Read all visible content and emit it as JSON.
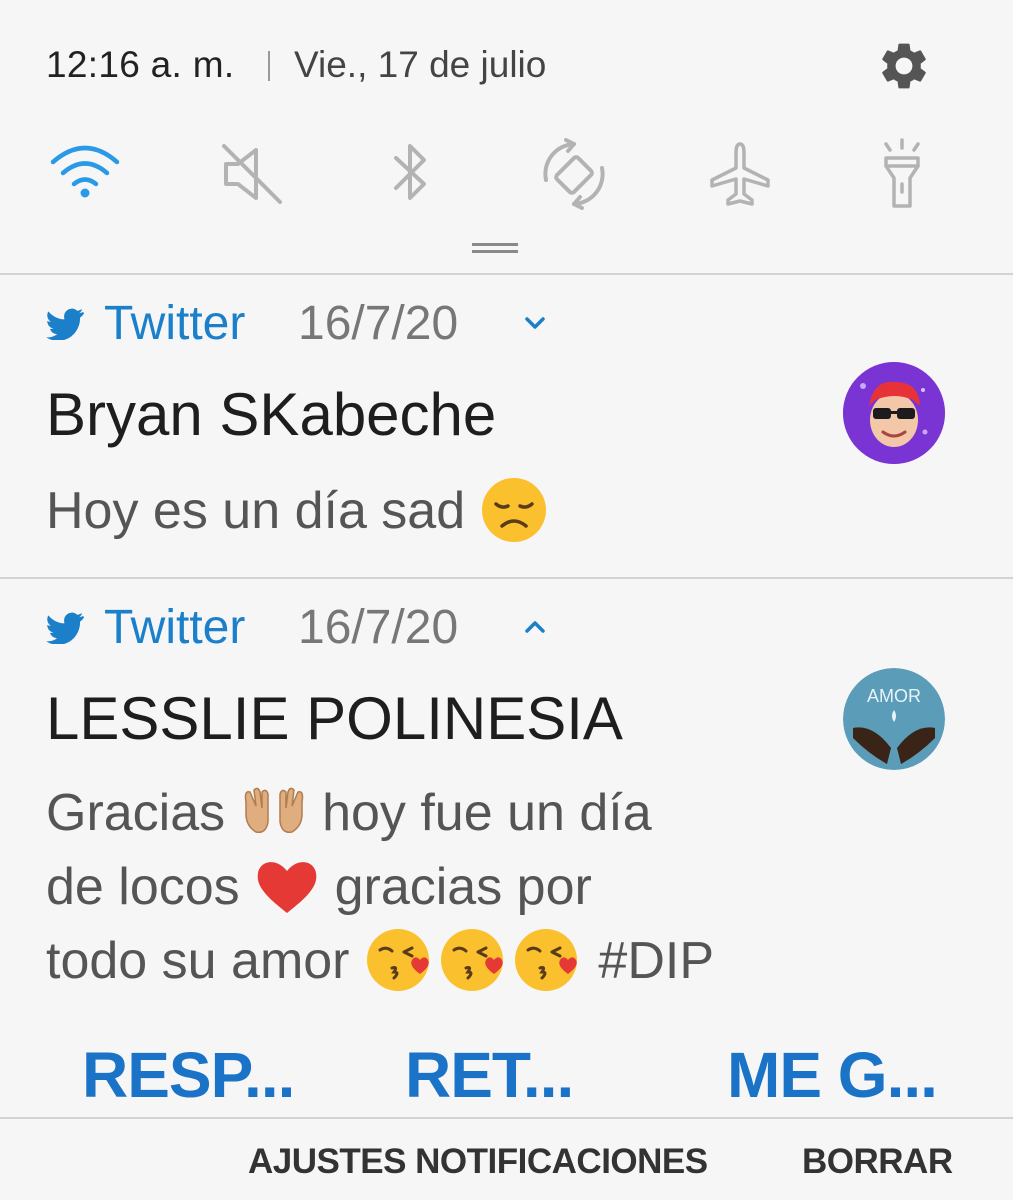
{
  "status": {
    "time": "12:16 a. m.",
    "date": "Vie., 17 de julio",
    "settings_icon": "gear-icon"
  },
  "quick_settings": [
    {
      "name": "wifi",
      "icon": "wifi-icon",
      "active": true
    },
    {
      "name": "sound",
      "icon": "mute-icon",
      "active": false
    },
    {
      "name": "bluetooth",
      "icon": "bluetooth-icon",
      "active": false
    },
    {
      "name": "auto-rotate",
      "icon": "rotate-icon",
      "active": false
    },
    {
      "name": "airplane-mode",
      "icon": "airplane-icon",
      "active": false
    },
    {
      "name": "flashlight",
      "icon": "flashlight-icon",
      "active": false
    }
  ],
  "notifications": [
    {
      "app": "Twitter",
      "date": "16/7/20",
      "expanded": false,
      "sender": "Bryan SKabeche",
      "message_lines": [
        "Hoy es un día sad"
      ]
    },
    {
      "app": "Twitter",
      "date": "16/7/20",
      "expanded": true,
      "sender": "LESSLIE POLINESIA",
      "message_lines": [
        "Gracias",
        "hoy fue un día",
        "de locos",
        "gracias por",
        "todo su amor",
        "#DIP"
      ],
      "avatar_text": "AMOR",
      "actions": [
        "RESP...",
        "RET...",
        "ME G..."
      ]
    }
  ],
  "footer": {
    "settings_label": "AJUSTES NOTIFICACIONES",
    "clear_label": "BORRAR"
  },
  "colors": {
    "accent": "#1b7fc9",
    "action_blue": "#1a73c6",
    "icon_inactive": "#b3b3b3",
    "background": "#f6f6f6"
  }
}
